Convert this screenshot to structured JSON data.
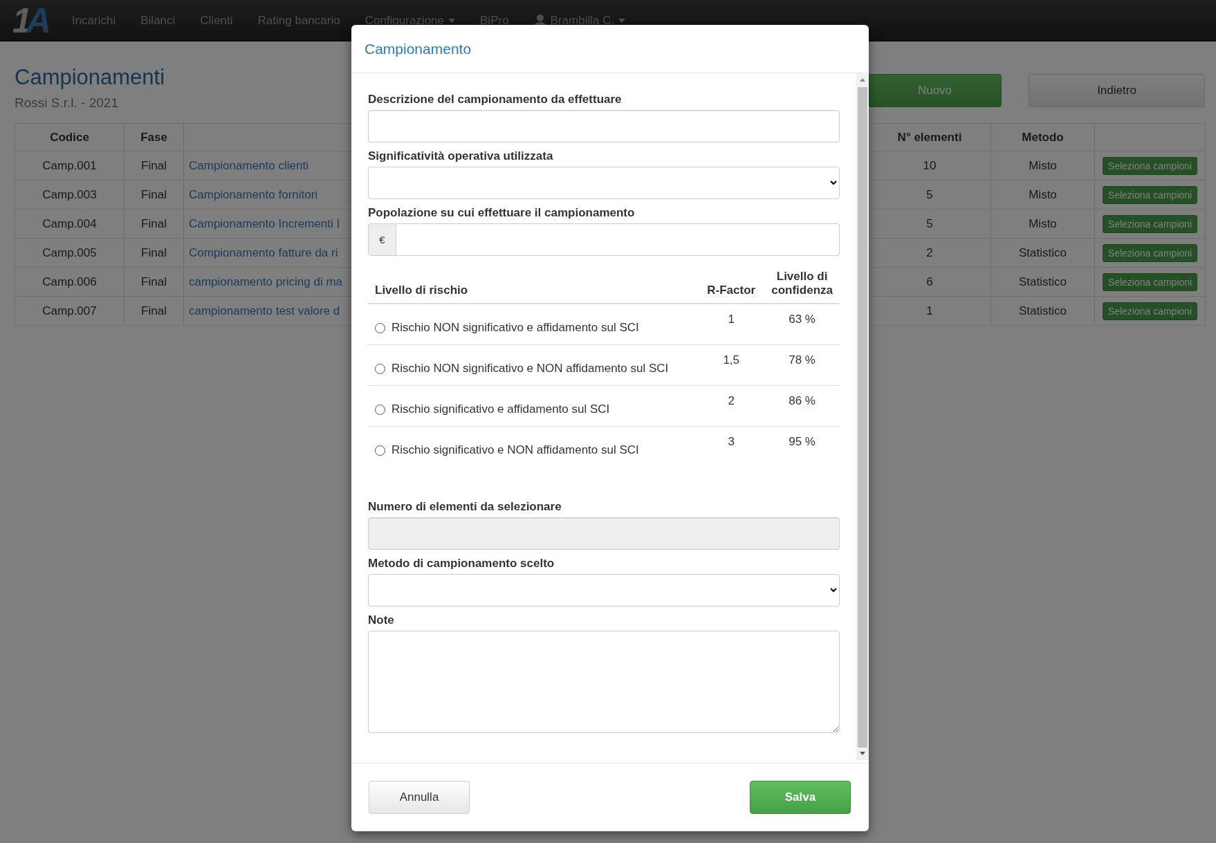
{
  "navbar": {
    "logo": {
      "digit": "1",
      "letter": "A"
    },
    "items": [
      {
        "label": "Incarichi",
        "kind": "link"
      },
      {
        "label": "Bilanci",
        "kind": "link"
      },
      {
        "label": "Clienti",
        "kind": "link"
      },
      {
        "label": "Rating bancario",
        "kind": "link"
      },
      {
        "label": "Configurazione",
        "kind": "dropdown"
      },
      {
        "label": "BiPro",
        "kind": "link"
      },
      {
        "label": "Brambilla C.",
        "kind": "user"
      }
    ]
  },
  "page": {
    "title": "Campionamenti",
    "subtitle": "Rossi S.r.l. - 2021",
    "buttons": [
      {
        "label": "Nuovo",
        "kind": "primary"
      },
      {
        "label": "Indietro",
        "kind": "default"
      }
    ]
  },
  "table": {
    "columns": [
      "Codice",
      "Fase",
      "N° elementi",
      "Metodo"
    ],
    "rows": [
      {
        "code": "Camp.001",
        "phase": "Final",
        "description": "Campionamento clienti",
        "count": "10",
        "method": "Misto",
        "action": "Seleziona campioni"
      },
      {
        "code": "Camp.003",
        "phase": "Final",
        "description": "Campionamento fornitori",
        "count": "5",
        "method": "Misto",
        "action": "Seleziona campioni"
      },
      {
        "code": "Camp.004",
        "phase": "Final",
        "description": "Campionamento Incrementi I",
        "count": "5",
        "method": "Misto",
        "action": "Seleziona campioni"
      },
      {
        "code": "Camp.005",
        "phase": "Final",
        "description": "Compionamento fatture da ri",
        "count": "2",
        "method": "Statistico",
        "action": "Seleziona campioni"
      },
      {
        "code": "Camp.006",
        "phase": "Final",
        "description": "campionamento pricing di ma",
        "count": "6",
        "method": "Statistico",
        "action": "Seleziona campioni"
      },
      {
        "code": "Camp.007",
        "phase": "Final",
        "description": "campionamento test valore d",
        "count": "1",
        "method": "Statistico",
        "action": "Seleziona campioni"
      }
    ]
  },
  "modal": {
    "title": "Campionamento",
    "fields": [
      {
        "kind": "text",
        "label": "Descrizione del campionamento da effettuare"
      },
      {
        "kind": "select",
        "label": "Significatività operativa utilizzata"
      },
      {
        "kind": "currency",
        "label": "Popolazione su cui effettuare il campionamento",
        "addon": "€"
      },
      {
        "kind": "risk_table",
        "columns": [
          "Livello di rischio",
          "R-Factor",
          "Livello di confidenza"
        ],
        "rows": [
          {
            "label": "Rischio NON significativo e affidamento sul SCI",
            "r_factor": "1",
            "confidence": "63 %",
            "selected": false
          },
          {
            "label": "Rischio NON significativo e NON affidamento sul SCI",
            "r_factor": "1,5",
            "confidence": "78 %",
            "selected": false
          },
          {
            "label": "Rischio significativo e affidamento sul SCI",
            "r_factor": "2",
            "confidence": "86 %",
            "selected": false
          },
          {
            "label": "Rischio significativo e NON affidamento sul SCI",
            "r_factor": "3",
            "confidence": "95 %",
            "selected": false
          }
        ]
      },
      {
        "kind": "text",
        "label": "Numero di elementi da selezionare",
        "disabled": true
      },
      {
        "kind": "select",
        "label": "Metodo di campionamento scelto"
      },
      {
        "kind": "textarea",
        "label": "Note"
      }
    ],
    "buttons": [
      {
        "label": "Annulla",
        "kind": "default"
      },
      {
        "label": "Salva",
        "kind": "primary"
      }
    ]
  }
}
